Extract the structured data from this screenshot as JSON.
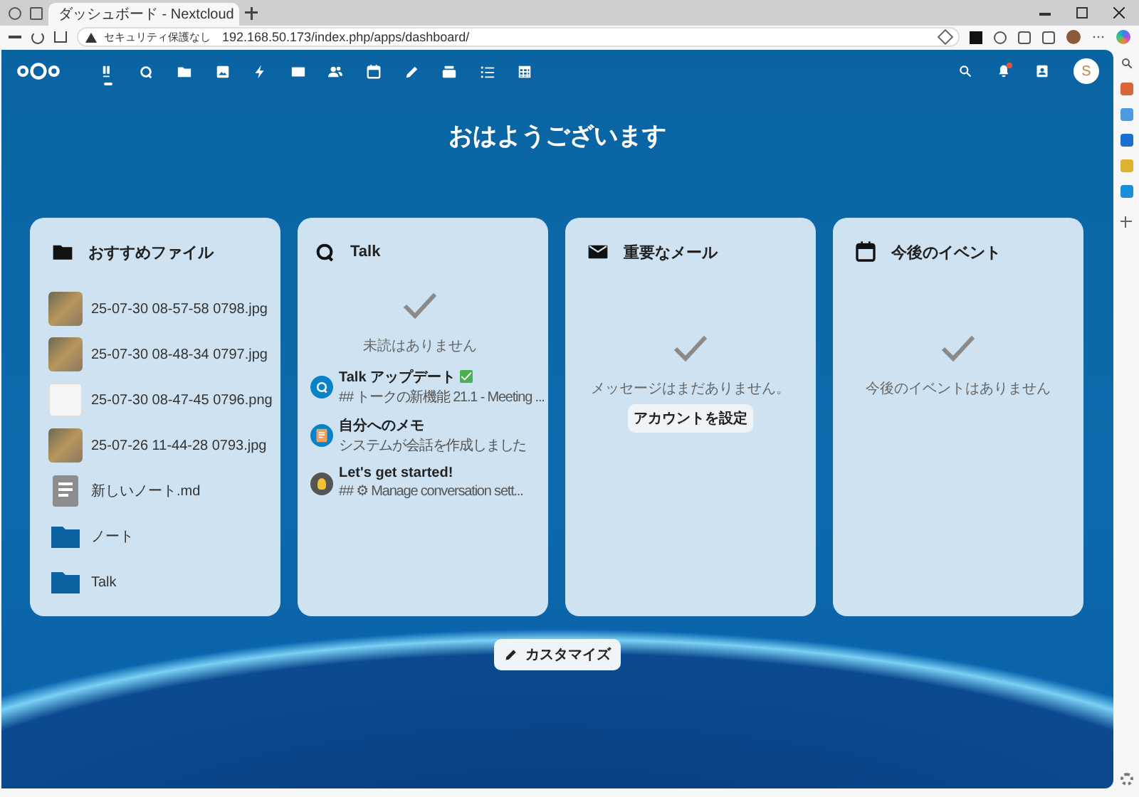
{
  "browser": {
    "tab_title": "ダッシュボード - Nextcloud",
    "security_label": "セキュリティ保護なし",
    "url": "192.168.50.173/index.php/apps/dashboard/"
  },
  "apps": [
    {
      "kind": "dashboard",
      "selected": true
    },
    {
      "kind": "talk",
      "selected": false
    },
    {
      "kind": "files",
      "selected": false
    },
    {
      "kind": "photos",
      "selected": false
    },
    {
      "kind": "activity",
      "selected": false
    },
    {
      "kind": "mail",
      "selected": false
    },
    {
      "kind": "contacts",
      "selected": false
    },
    {
      "kind": "calendar",
      "selected": false
    },
    {
      "kind": "notes",
      "selected": false
    },
    {
      "kind": "deck",
      "selected": false
    },
    {
      "kind": "tasks",
      "selected": false
    },
    {
      "kind": "tables",
      "selected": false
    }
  ],
  "header": {
    "notifications_unread": true,
    "avatar_letter": "S"
  },
  "greeting": "おはようございます",
  "widgets": [
    {
      "kind": "files",
      "title": "おすすめファイル",
      "items": [
        {
          "kind": "photo",
          "name": "25-07-30 08-57-58 0798.jpg"
        },
        {
          "kind": "photo",
          "name": "25-07-30 08-48-34 0797.jpg"
        },
        {
          "kind": "screenshot",
          "name": "25-07-30 08-47-45 0796.png"
        },
        {
          "kind": "photo",
          "name": "25-07-26 11-44-28 0793.jpg"
        },
        {
          "kind": "document",
          "name": "新しいノート.md"
        },
        {
          "kind": "folder",
          "name": "ノート"
        },
        {
          "kind": "folder",
          "name": "Talk"
        }
      ]
    },
    {
      "kind": "talk",
      "title": "Talk",
      "empty_text": "未読はありません",
      "conversations": [
        {
          "kind": "talk",
          "title": "Talk アップデート",
          "verified": true,
          "subtitle": "## トークの新機能 21.1 - Meeting ..."
        },
        {
          "kind": "note",
          "title": "自分へのメモ",
          "verified": false,
          "subtitle": "システムが会話を作成しました"
        },
        {
          "kind": "bulb",
          "title": "Let's get started!",
          "verified": false,
          "subtitle": "## ⚙ Manage conversation sett..."
        }
      ]
    },
    {
      "kind": "mail",
      "title": "重要なメール",
      "empty_text": "メッセージはまだありません。",
      "button": "アカウントを設定"
    },
    {
      "kind": "events",
      "title": "今後のイベント",
      "empty_text": "今後のイベントはありません"
    }
  ],
  "customize_button": "カスタマイズ"
}
